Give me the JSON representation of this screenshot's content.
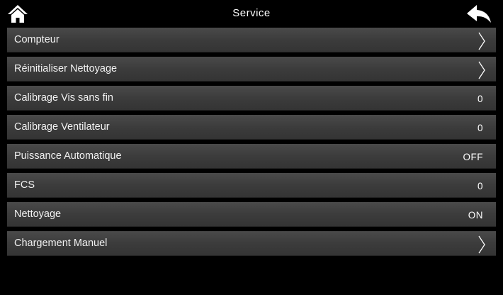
{
  "header": {
    "title": "Service"
  },
  "colors": {
    "background": "#000000",
    "row": "#3c3c3c",
    "text": "#ffffff"
  },
  "icons": {
    "home": "home-icon",
    "back": "back-arrow-icon",
    "chevron": "chevron-right-icon"
  },
  "menu": {
    "items": [
      {
        "label": "Compteur",
        "type": "submenu"
      },
      {
        "label": "Réinitialiser Nettoyage",
        "type": "submenu"
      },
      {
        "label": "Calibrage Vis sans fin",
        "type": "value",
        "value": "0"
      },
      {
        "label": "Calibrage Ventilateur",
        "type": "value",
        "value": "0"
      },
      {
        "label": "Puissance Automatique",
        "type": "value",
        "value": "OFF"
      },
      {
        "label": "FCS",
        "type": "value",
        "value": "0"
      },
      {
        "label": "Nettoyage",
        "type": "value",
        "value": "ON"
      },
      {
        "label": "Chargement Manuel",
        "type": "submenu"
      }
    ]
  }
}
